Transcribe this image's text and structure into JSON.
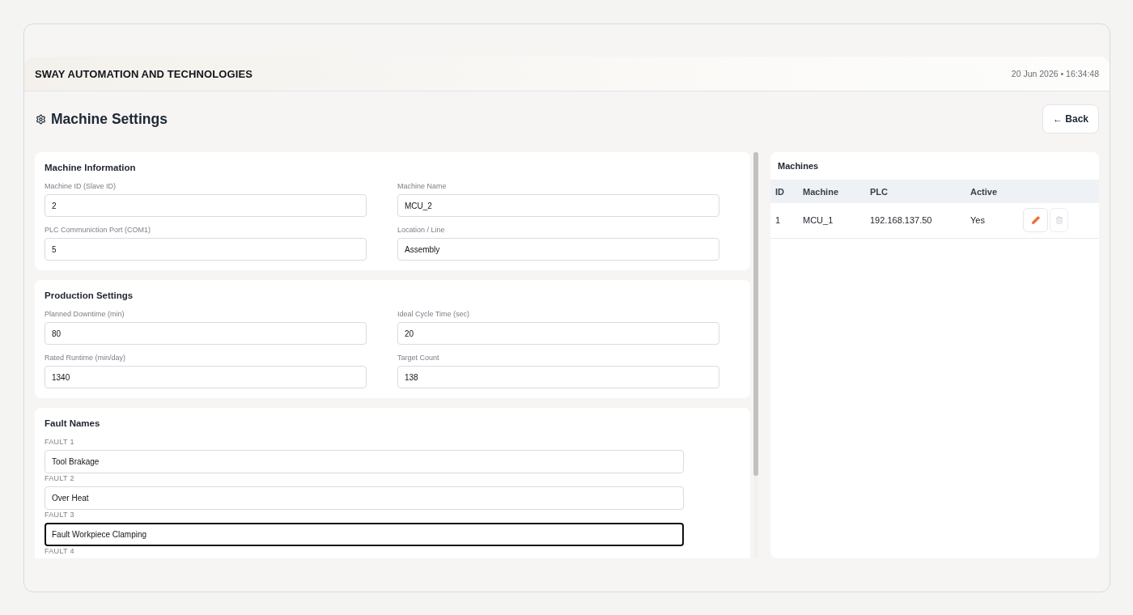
{
  "header": {
    "company": "SWAY AUTOMATION AND TECHNOLOGIES",
    "datetime": "20 Jun 2026 • 16:34:48"
  },
  "page": {
    "title": "Machine Settings",
    "back_button": "← Back"
  },
  "sections": [
    {
      "title": "Machine Information",
      "kind": "grid",
      "fields": [
        {
          "label": "Machine ID (Slave ID)",
          "value": "2",
          "focused": false
        },
        {
          "label": "Machine Name",
          "value": "MCU_2",
          "focused": false
        },
        {
          "label": "PLC Communiction Port (COM1)",
          "value": "5",
          "focused": false
        },
        {
          "label": "Location / Line",
          "value": "Assembly",
          "focused": false
        }
      ]
    },
    {
      "title": "Production Settings",
      "kind": "grid",
      "fields": [
        {
          "label": "Planned Downtime (min)",
          "value": "80",
          "focused": false
        },
        {
          "label": "Ideal Cycle Time (sec)",
          "value": "20",
          "focused": false
        },
        {
          "label": "Rated Runtime (min/day)",
          "value": "1340",
          "focused": false
        },
        {
          "label": "Target Count",
          "value": "138",
          "focused": false
        }
      ]
    },
    {
      "title": "Fault Names",
      "kind": "list",
      "fields": [
        {
          "label": "FAULT 1",
          "value": "Tool Brakage",
          "focused": false
        },
        {
          "label": "FAULT 2",
          "value": "Over Heat",
          "focused": false
        },
        {
          "label": "FAULT 3",
          "value": "Fault Workpiece Clamping",
          "focused": true
        },
        {
          "label": "FAULT 4"
        }
      ]
    }
  ],
  "machines": {
    "title": "Machines",
    "columns": [
      "ID",
      "Machine",
      "PLC",
      "Active"
    ],
    "rows": [
      {
        "cells": [
          "1",
          "MCU_1",
          "192.168.137.50",
          "Yes"
        ],
        "actions": [
          {
            "kind": "edit",
            "disabled": false
          },
          {
            "kind": "delete",
            "disabled": true
          }
        ]
      }
    ]
  }
}
